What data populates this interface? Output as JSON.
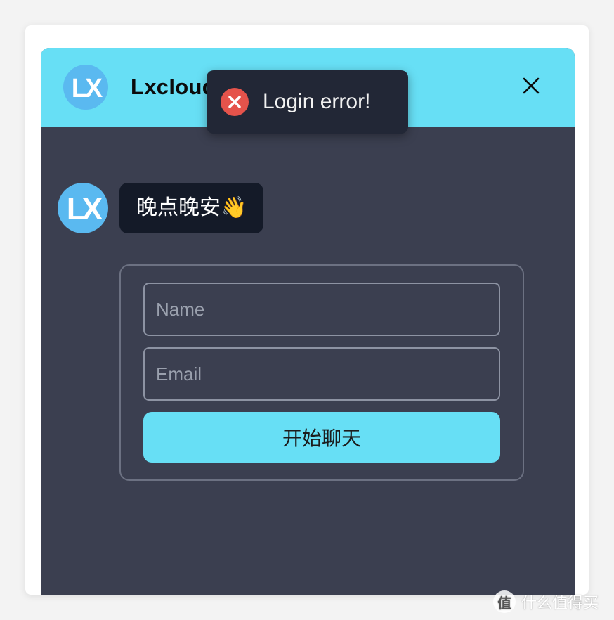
{
  "header": {
    "brand_name": "Lxcloud",
    "logo_text": "LX",
    "close_label": "×"
  },
  "toast": {
    "message": "Login error!",
    "icon": "error-x-icon",
    "icon_color": "#e5534b"
  },
  "chat": {
    "greeting": "晚点晚安👋",
    "bot_logo_text": "LX"
  },
  "form": {
    "name_placeholder": "Name",
    "email_placeholder": "Email",
    "name_value": "",
    "email_value": "",
    "start_button_label": "开始聊天"
  },
  "watermark": {
    "text": "什么值得买",
    "symbol": "值"
  },
  "colors": {
    "accent": "#67dff5",
    "panel_bg": "#3b3f50",
    "bubble_bg": "#141a28",
    "toast_bg": "#222736",
    "logo_bg": "#5ab9f0"
  }
}
